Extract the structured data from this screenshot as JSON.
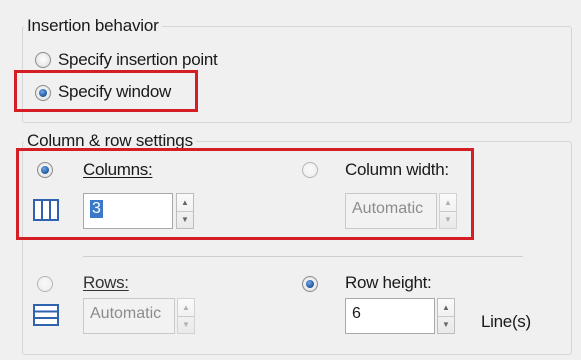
{
  "insertion_behavior": {
    "title": "Insertion behavior",
    "options": [
      {
        "label": "Specify insertion point",
        "checked": false
      },
      {
        "label": "Specify window",
        "checked": true
      }
    ]
  },
  "column_row_settings": {
    "title": "Column & row settings",
    "columns": {
      "label": "Columns:",
      "checked": true,
      "value": "3"
    },
    "column_width": {
      "label": "Column width:",
      "checked": false,
      "value": "Automatic"
    },
    "rows": {
      "label": "Rows:",
      "checked": false,
      "value": "Automatic"
    },
    "row_height": {
      "label": "Row height:",
      "checked": true,
      "value": "6",
      "unit": "Line(s)"
    }
  },
  "colors": {
    "highlight": "#d41d24",
    "accent": "#2a5fa8",
    "selection": "#3a78c9"
  },
  "icons": [
    "columns-icon",
    "rows-icon"
  ]
}
